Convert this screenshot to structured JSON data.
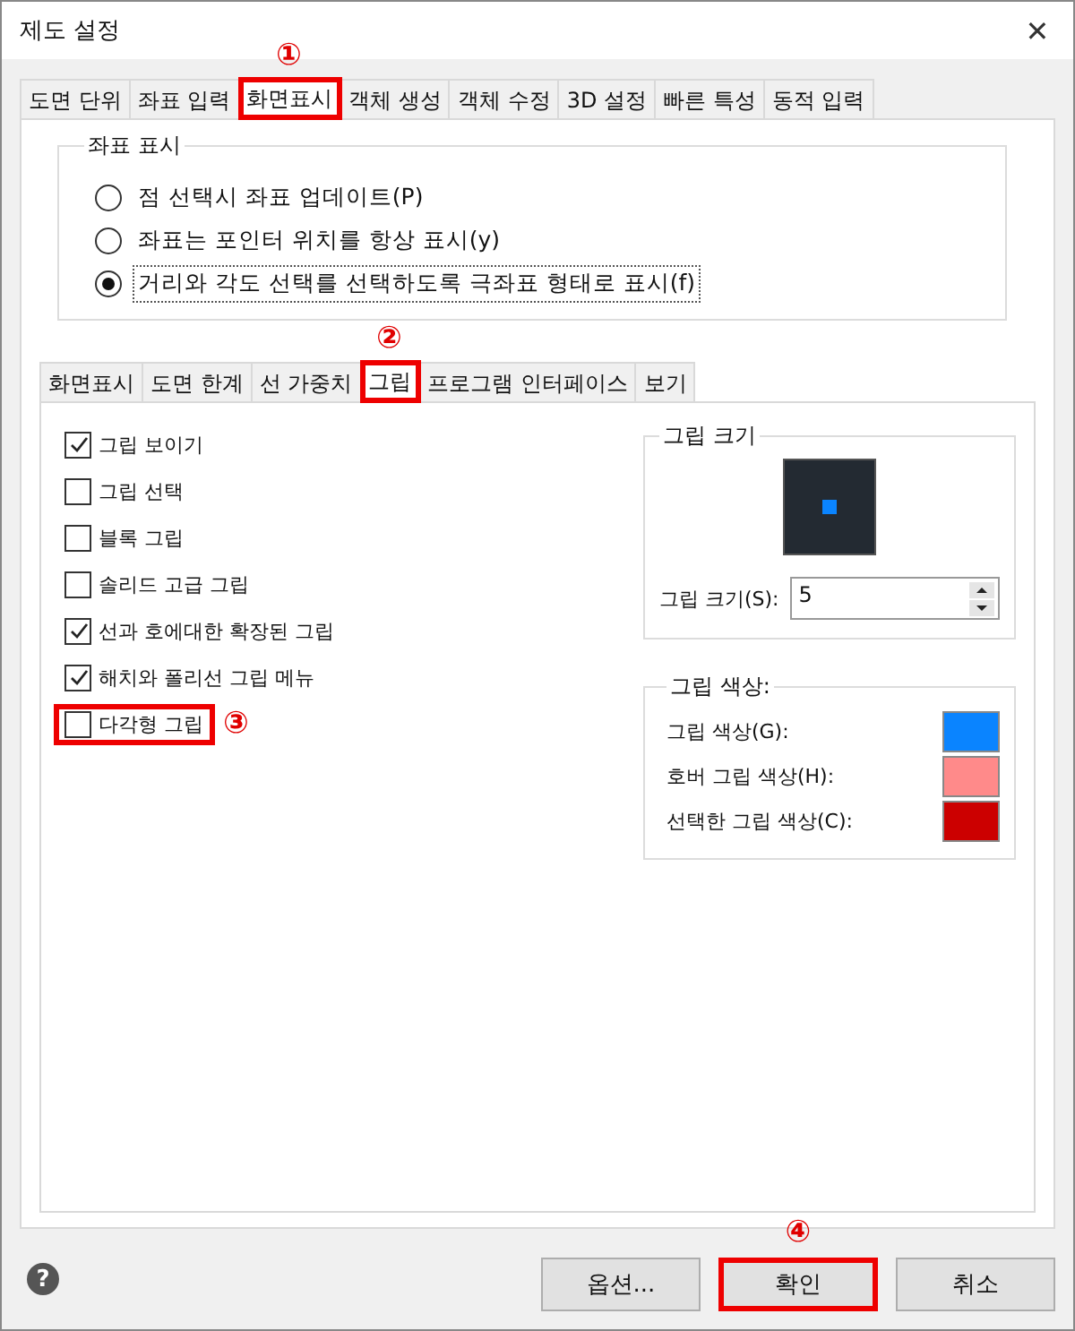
{
  "window": {
    "title": "제도 설정",
    "close": "✕"
  },
  "tabs": [
    {
      "label": "도면 단위",
      "selected": false
    },
    {
      "label": "좌표 입력",
      "selected": false
    },
    {
      "label": "화면표시",
      "selected": true,
      "callout": "①"
    },
    {
      "label": "객체 생성",
      "selected": false
    },
    {
      "label": "객체 수정",
      "selected": false
    },
    {
      "label": "3D 설정",
      "selected": false
    },
    {
      "label": "빠른 특성",
      "selected": false
    },
    {
      "label": "동적 입력",
      "selected": false
    }
  ],
  "coord_group": {
    "title": "좌표 표시",
    "options": [
      {
        "label": "점 선택시 좌표 업데이트(P)",
        "selected": false,
        "focused": false
      },
      {
        "label": "좌표는 포인터 위치를 항상 표시(y)",
        "selected": false,
        "focused": false
      },
      {
        "label": "거리와 각도 선택를 선택하도록 극좌표 형태로 표시(f)",
        "selected": true,
        "focused": true
      }
    ]
  },
  "sub_tabs": [
    {
      "label": "화면표시",
      "selected": false
    },
    {
      "label": "도면 한계",
      "selected": false
    },
    {
      "label": "선 가중치",
      "selected": false
    },
    {
      "label": "그립",
      "selected": true,
      "callout": "②"
    },
    {
      "label": "프로그램 인터페이스",
      "selected": false
    },
    {
      "label": "보기",
      "selected": false
    }
  ],
  "grip_options": [
    {
      "label": "그립 보이기",
      "checked": true
    },
    {
      "label": "그립 선택",
      "checked": false
    },
    {
      "label": "블록 그립",
      "checked": false
    },
    {
      "label": "솔리드 고급 그립",
      "checked": false
    },
    {
      "label": "선과 호에대한 확장된 그립",
      "checked": true
    },
    {
      "label": "해치와 폴리선 그립 메뉴",
      "checked": true
    },
    {
      "label": "다각형 그립",
      "checked": false,
      "callout": "③"
    }
  ],
  "grip_size": {
    "title": "그립 크기",
    "label": "그립 크기(S):",
    "value": "5"
  },
  "grip_colors": {
    "title": "그립 색상:",
    "items": [
      {
        "label": "그립 색상(G):",
        "color": "#0a84ff"
      },
      {
        "label": "호버 그립 색상(H):",
        "color": "#ff8a8a"
      },
      {
        "label": "선택한 그립 색상(C):",
        "color": "#cc0000"
      }
    ]
  },
  "help": "?",
  "buttons": [
    {
      "label": "옵션..."
    },
    {
      "label": "확인",
      "callout": "④"
    },
    {
      "label": "취소"
    }
  ]
}
